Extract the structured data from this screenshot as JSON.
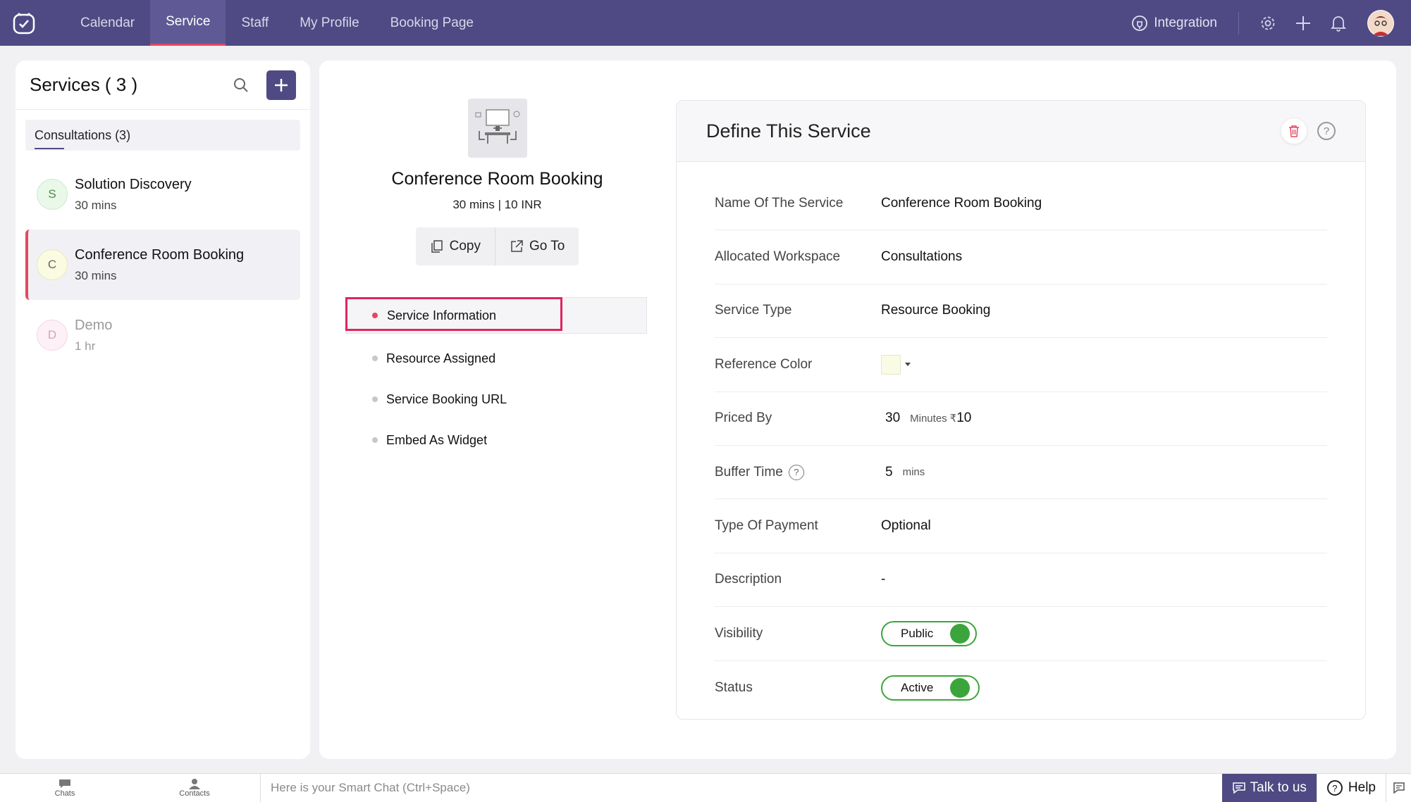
{
  "nav": {
    "items": [
      "Calendar",
      "Service",
      "Staff",
      "My Profile",
      "Booking Page"
    ],
    "active": "Service",
    "integration": "Integration"
  },
  "left": {
    "title": "Services ( 3 )",
    "workspace_tab": "Consultations (3)",
    "services": [
      {
        "initial": "S",
        "name": "Solution Discovery",
        "duration": "30 mins"
      },
      {
        "initial": "C",
        "name": "Conference Room Booking",
        "duration": "30 mins"
      },
      {
        "initial": "D",
        "name": "Demo",
        "duration": "1 hr"
      }
    ]
  },
  "service": {
    "title": "Conference Room Booking",
    "meta": "30 mins | 10 INR",
    "copy_label": "Copy",
    "goto_label": "Go To"
  },
  "menu": [
    "Service Information",
    "Resource Assigned",
    "Service Booking URL",
    "Embed As Widget"
  ],
  "card": {
    "title": "Define This Service",
    "fields": {
      "name_label": "Name Of The Service",
      "name_value": "Conference Room Booking",
      "workspace_label": "Allocated Workspace",
      "workspace_value": "Consultations",
      "type_label": "Service Type",
      "type_value": "Resource Booking",
      "color_label": "Reference Color",
      "color_value": "#fafbe4",
      "priced_label": "Priced By",
      "priced_minutes": "30",
      "priced_unit": "Minutes",
      "priced_currency": "₹",
      "priced_amount": "10",
      "buffer_label": "Buffer Time",
      "buffer_value": "5",
      "buffer_unit": "mins",
      "payment_label": "Type Of Payment",
      "payment_value": "Optional",
      "desc_label": "Description",
      "desc_value": "-",
      "visibility_label": "Visibility",
      "visibility_value": "Public",
      "status_label": "Status",
      "status_value": "Active"
    }
  },
  "bottom": {
    "chats": "Chats",
    "contacts": "Contacts",
    "chat_placeholder": "Here is your Smart Chat (Ctrl+Space)",
    "talk": "Talk to us",
    "help": "Help"
  },
  "colors": {
    "brand": "#4f4a83",
    "accent": "#e5485e",
    "toggle": "#3ba53b"
  }
}
